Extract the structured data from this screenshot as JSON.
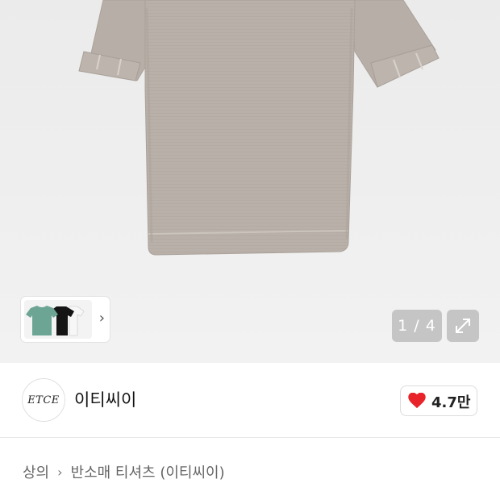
{
  "gallery": {
    "page_counter": "1 / 4",
    "thumb_arrow": "›",
    "icons": {
      "expand": "expand-arrows-icon",
      "next": "chevron-right-icon"
    }
  },
  "brand": {
    "logo_text": "ETCE",
    "name": "이티씨이"
  },
  "like": {
    "count": "4.7만",
    "icon": "heart-icon",
    "color": "#e8232a"
  },
  "breadcrumb": {
    "items": [
      "상의",
      "반소매 티셔츠 (이티씨이)"
    ],
    "separator": "›"
  }
}
